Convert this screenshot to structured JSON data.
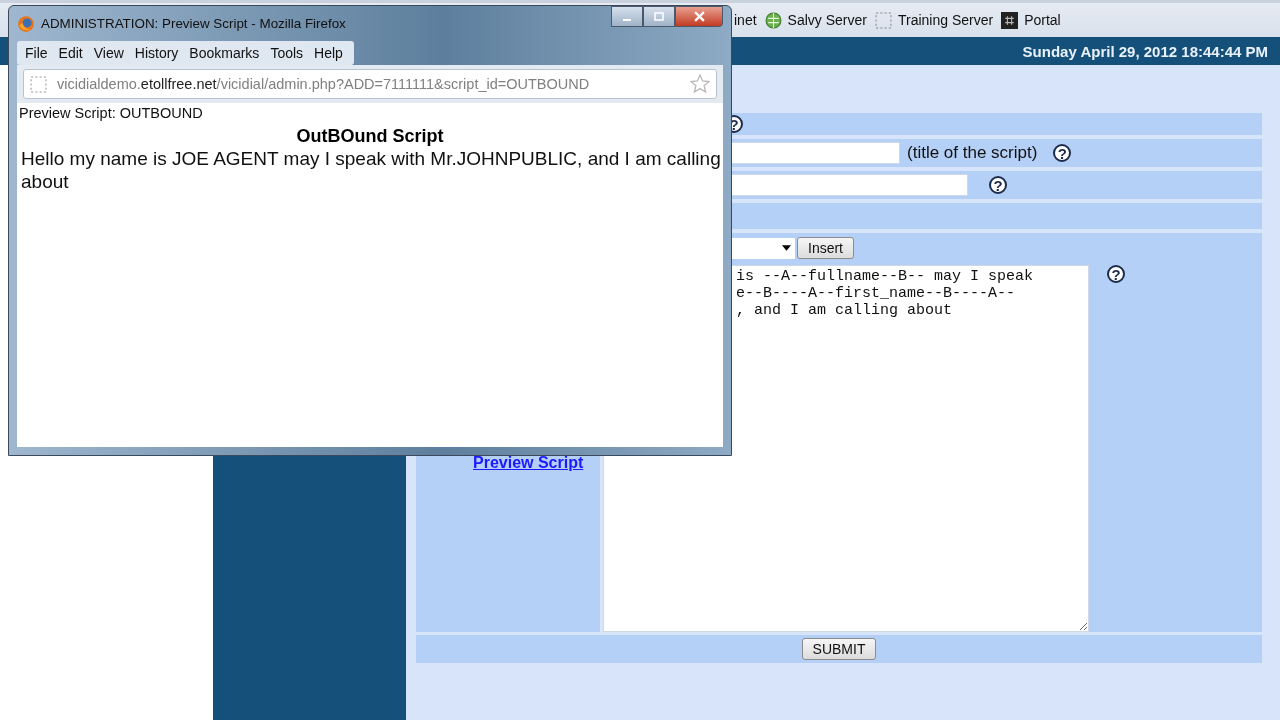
{
  "bookmarks": [
    {
      "label": "inet"
    },
    {
      "label": "Salvy Server"
    },
    {
      "label": "Training Server"
    },
    {
      "label": "Portal"
    }
  ],
  "header": {
    "date": "Sunday April 29, 2012 18:44:44 PM"
  },
  "form": {
    "rows": [
      {
        "kind": "help",
        "help": "?"
      },
      {
        "kind": "input",
        "note": "(title of the script)",
        "help": "?"
      },
      {
        "kind": "input",
        "help": "?"
      },
      {
        "kind": "empty"
      },
      {
        "kind": "script",
        "button": "Insert",
        "text": "is --A--fullname--B-- may I speak\ne--B----A--first_name--B----A--\n, and I am calling about",
        "help": "?",
        "link": "Preview Script"
      }
    ],
    "submit": "SUBMIT"
  },
  "popup": {
    "title": "ADMINISTRATION: Preview Script - Mozilla Firefox",
    "menu": [
      "File",
      "Edit",
      "View",
      "History",
      "Bookmarks",
      "Tools",
      "Help"
    ],
    "url": "vicidialdemo.**etollfree.net**/vicidial/admin.php?ADD=7111111&script_id=OUTBOUND",
    "page_heading": "Preview Script: OUTBOUND",
    "script_title": "OutBOund Script",
    "script_body": "Hello my name is JOE AGENT may I speak with Mr.JOHNPUBLIC, and I am calling about"
  }
}
